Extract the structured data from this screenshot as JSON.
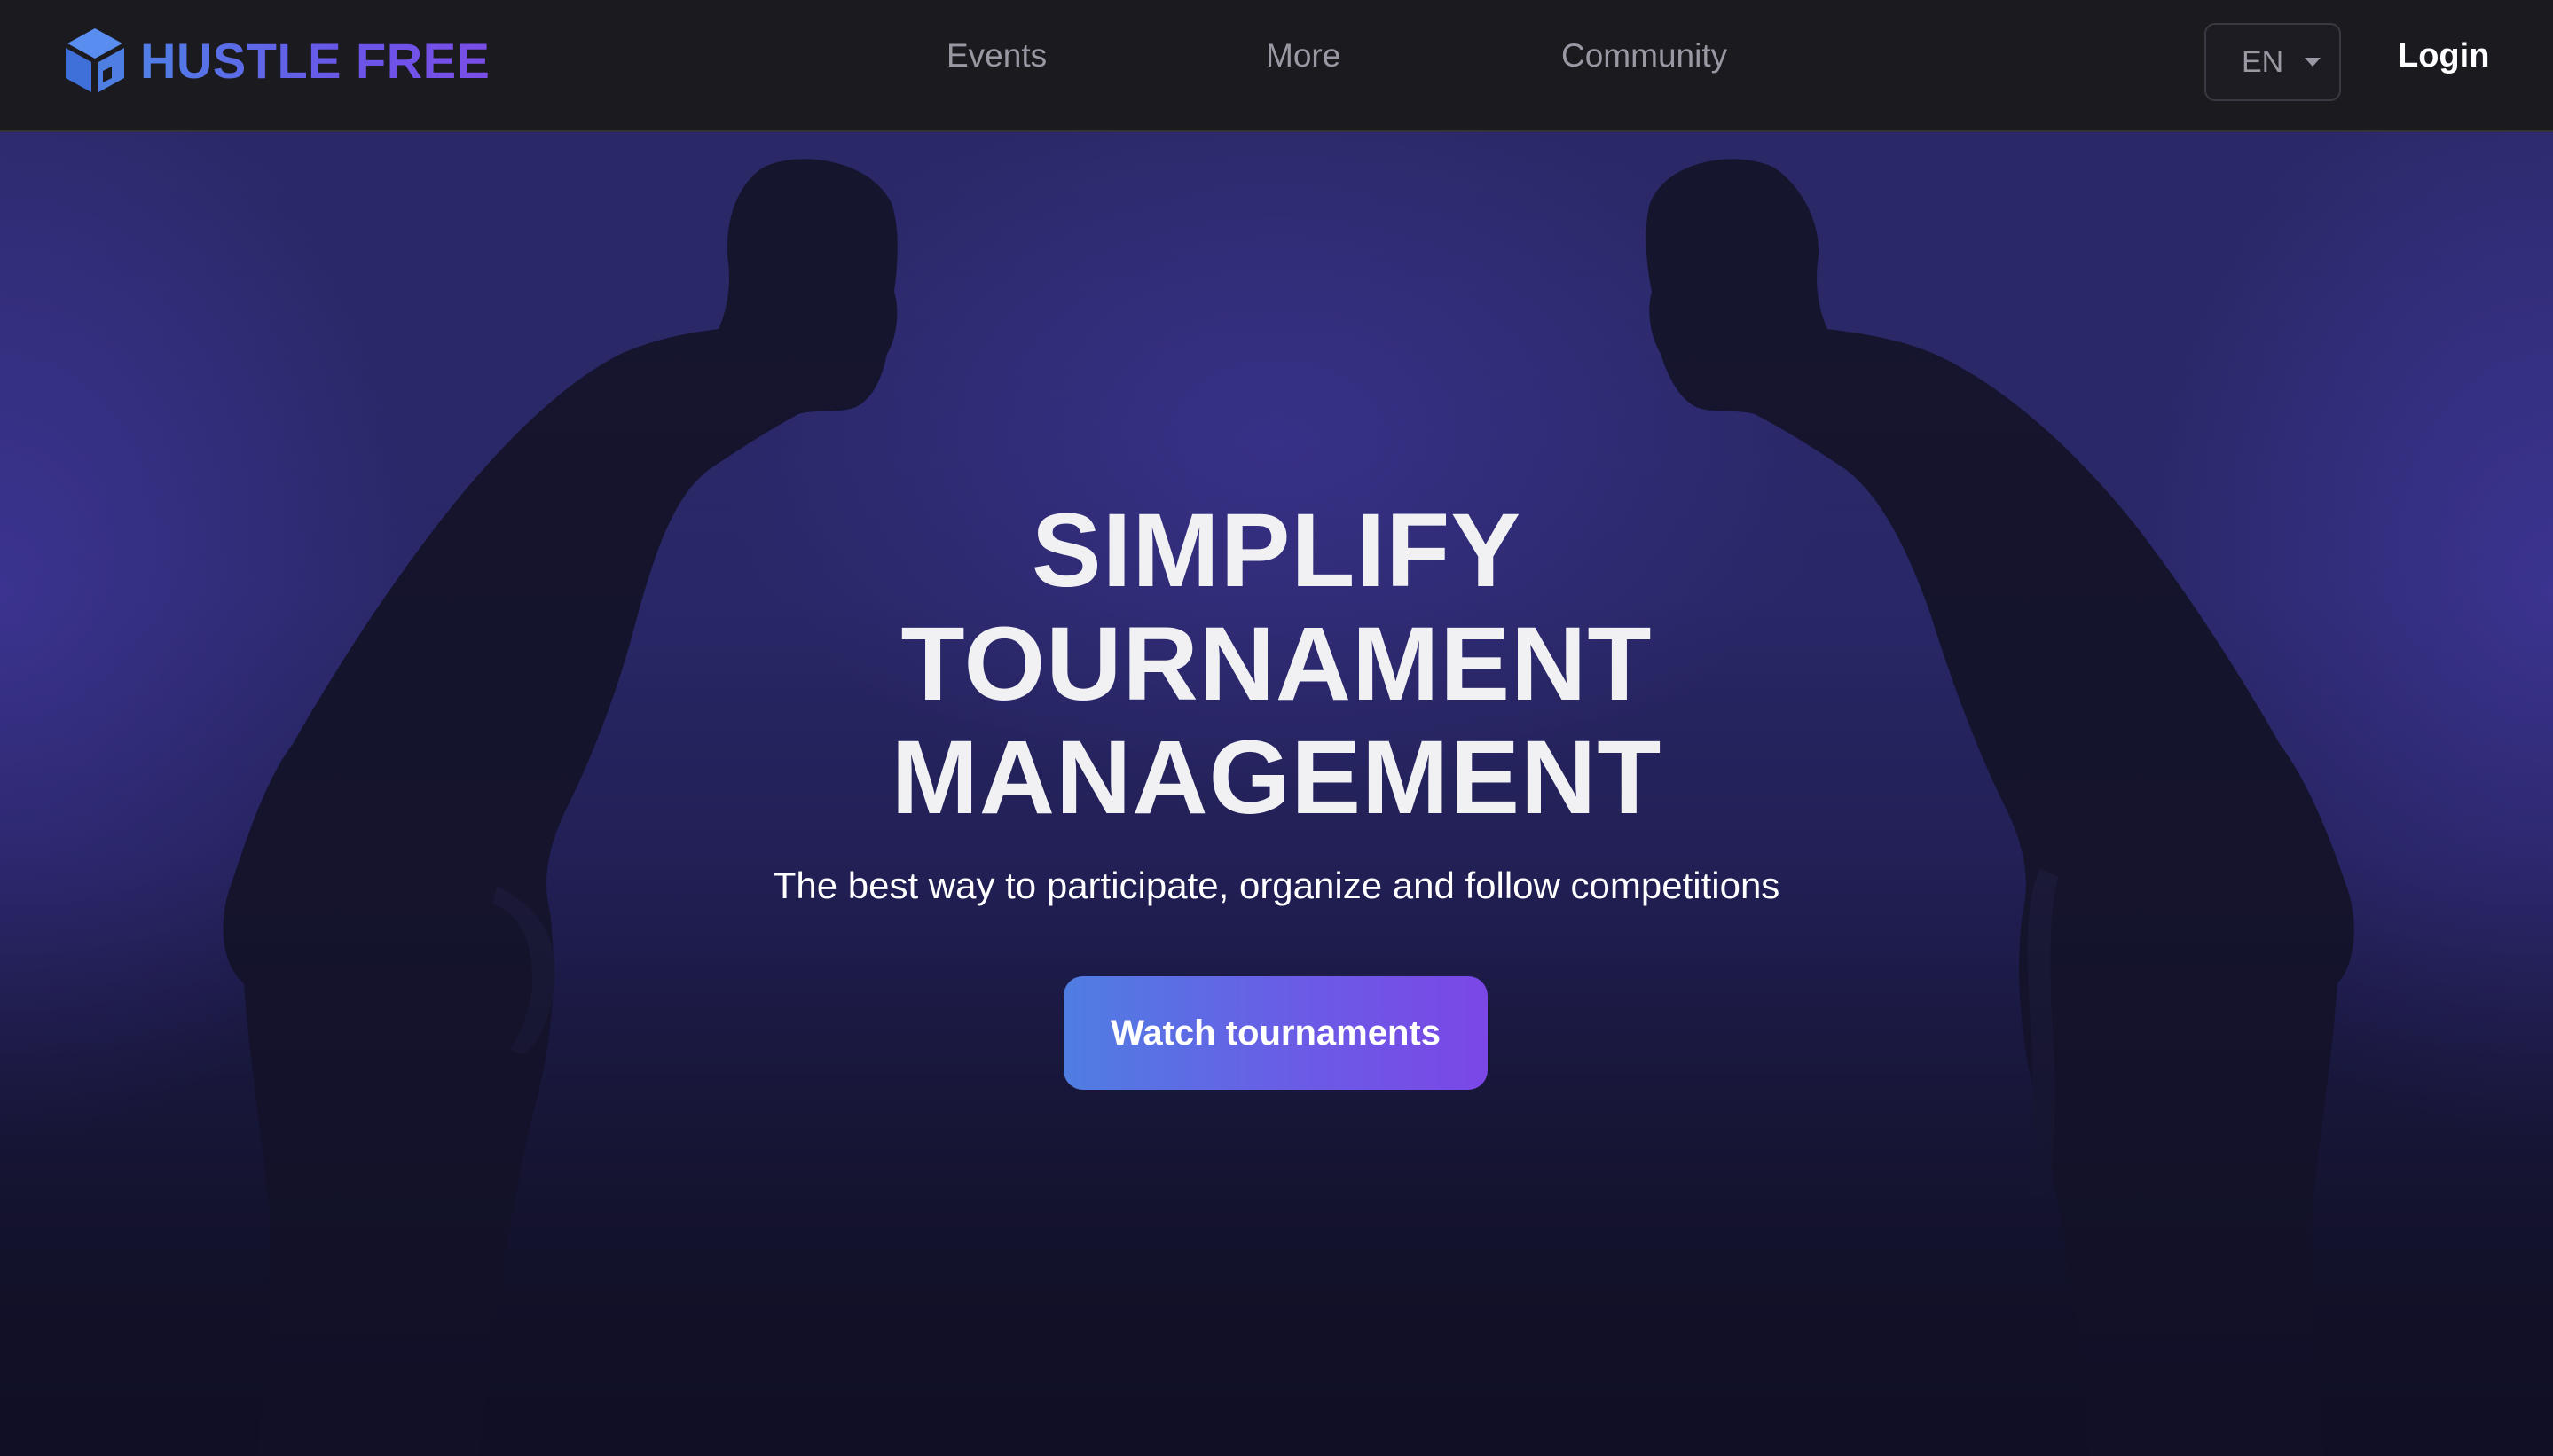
{
  "brand": {
    "name": "HUSTLE FREE",
    "logo_icon": "cube-logo-icon",
    "gradient": [
      "#4f7fe6",
      "#7a4ee8"
    ]
  },
  "nav": {
    "links": [
      {
        "label": "Events"
      },
      {
        "label": "More"
      },
      {
        "label": "Community"
      }
    ],
    "language": {
      "selected": "EN",
      "icon": "caret-down-icon"
    },
    "login_label": "Login"
  },
  "hero": {
    "title_lines": [
      "SIMPLIFY",
      "TOURNAMENT",
      "MANAGEMENT"
    ],
    "subtitle": "The best way to participate, organize and follow competitions",
    "cta_label": "Watch tournaments",
    "background_image": "two-martial-artists-bowing-silhouette"
  },
  "colors": {
    "navbar_bg": "#1b1a1f",
    "hero_bg": "#2a2866",
    "accent_start": "#4f7ee2",
    "accent_end": "#7b47e6",
    "nav_text": "#9a99a3"
  }
}
